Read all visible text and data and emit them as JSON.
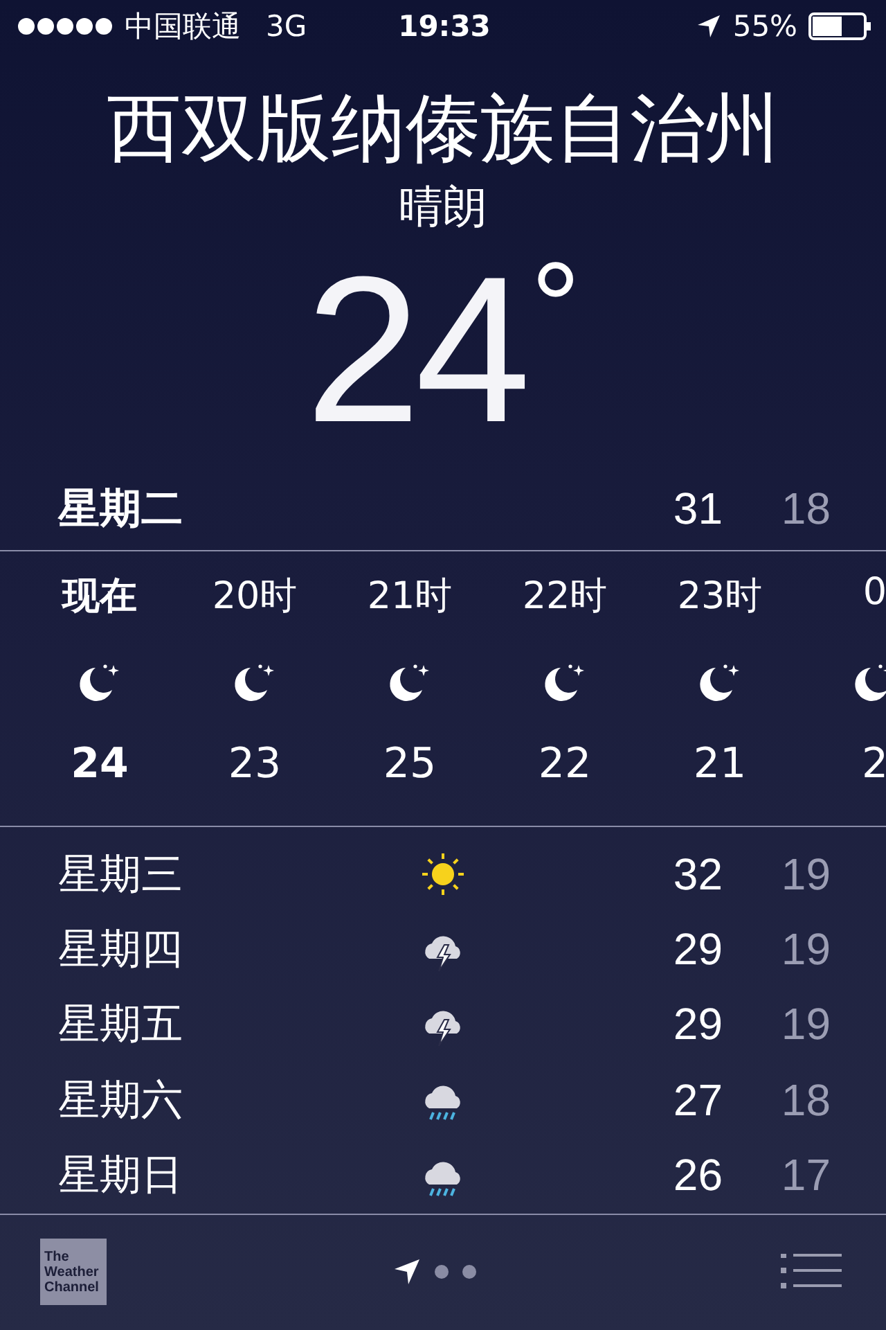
{
  "status_bar": {
    "carrier": "中国联通",
    "network": "3G",
    "time": "19:33",
    "battery": "55%"
  },
  "location": {
    "city": "西双版纳傣族自治州",
    "condition": "晴朗",
    "temperature": "24",
    "degree": "°"
  },
  "today": {
    "day": "星期二",
    "high": "31",
    "low": "18"
  },
  "hourly": [
    {
      "time": "现在",
      "temp": "24",
      "kind": "night",
      "selected": true
    },
    {
      "time": "20时",
      "temp": "23",
      "kind": "night",
      "selected": false
    },
    {
      "time": "21时",
      "temp": "25",
      "kind": "night",
      "selected": false
    },
    {
      "time": "22时",
      "temp": "22",
      "kind": "night",
      "selected": false
    },
    {
      "time": "23时",
      "temp": "21",
      "kind": "night",
      "selected": false
    },
    {
      "time": "0",
      "temp": "2",
      "kind": "night",
      "selected": false
    }
  ],
  "daily": [
    {
      "day": "星期三",
      "kind": "sunny",
      "high": "32",
      "low": "19"
    },
    {
      "day": "星期四",
      "kind": "thunderstorm",
      "high": "29",
      "low": "19"
    },
    {
      "day": "星期五",
      "kind": "thunderstorm",
      "high": "29",
      "low": "19"
    },
    {
      "day": "星期六",
      "kind": "rain",
      "high": "27",
      "low": "18"
    },
    {
      "day": "星期日",
      "kind": "rain",
      "high": "26",
      "low": "17"
    }
  ],
  "footer": {
    "logo": [
      "The",
      "Weather",
      "Channel"
    ],
    "pages": [
      {
        "kind": "location",
        "selected": true
      },
      {
        "kind": "dot",
        "selected": false
      },
      {
        "kind": "dot",
        "selected": false
      }
    ]
  }
}
